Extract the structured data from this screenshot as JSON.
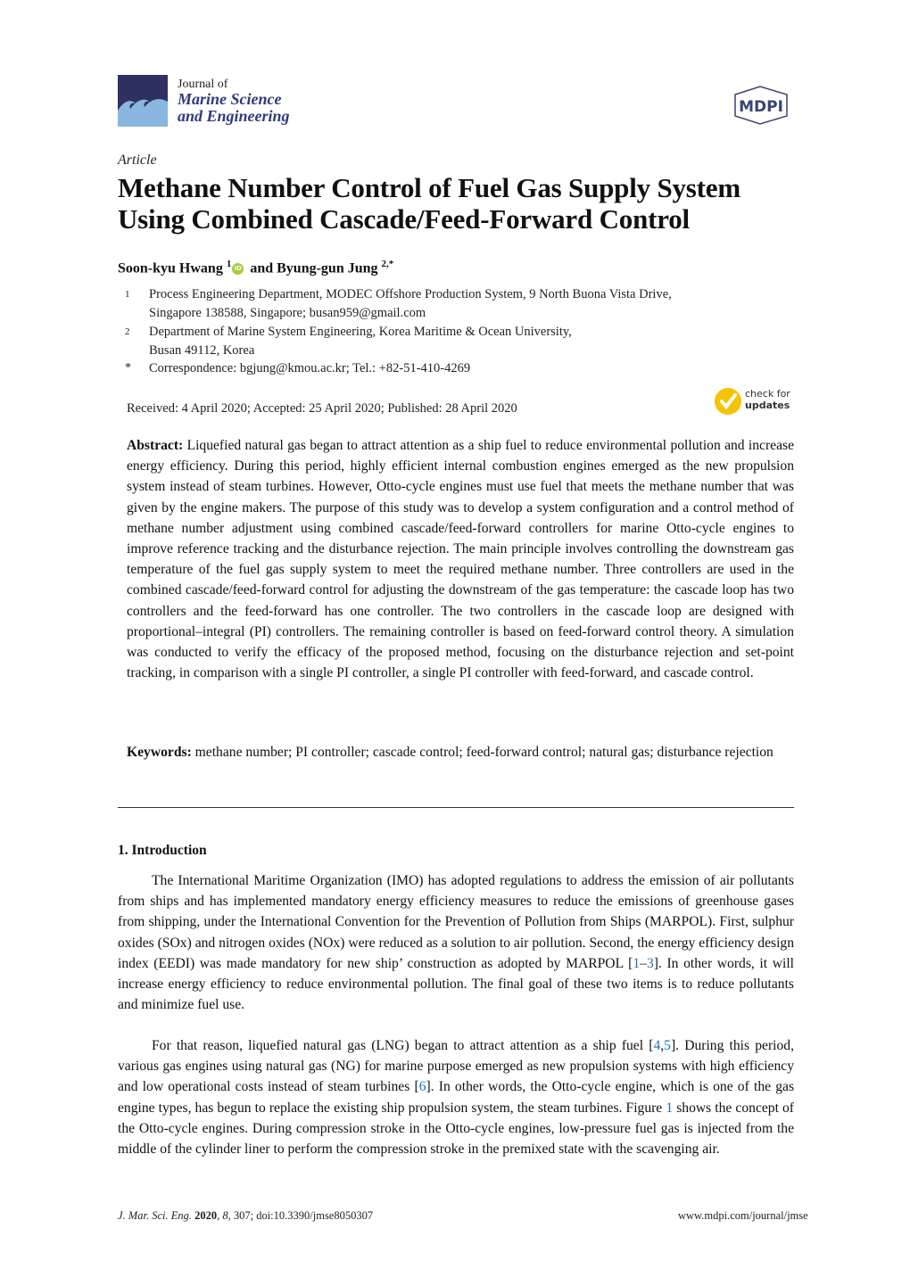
{
  "header": {
    "journal_line1": "Journal of",
    "journal_line2": "Marine Science",
    "journal_line3": "and Engineering",
    "publisher_logo": "MDPI",
    "logo_colors": {
      "navy": "#2f3160",
      "wave": "#8ab6e0",
      "title": "#2f3a7a"
    }
  },
  "article": {
    "type": "Article",
    "title_line1": "Methane Number Control of Fuel Gas Supply System",
    "title_line2": "Using Combined Cascade/Feed-Forward Control"
  },
  "authors": {
    "author1": "Soon-kyu Hwang",
    "author1_sup": "1",
    "and": "and",
    "author2": "Byung-gun Jung",
    "author2_sup": "2,*",
    "orcid_label": "iD"
  },
  "affiliations": [
    {
      "mark": "1",
      "line1": "Process Engineering Department, MODEC Offshore Production System, 9 North Buona Vista Drive,",
      "line2": "Singapore 138588, Singapore; busan959@gmail.com"
    },
    {
      "mark": "2",
      "line1": "Department of Marine System Engineering, Korea Maritime & Ocean University,",
      "line2": "Busan 49112, Korea"
    },
    {
      "mark": "*",
      "line1": "Correspondence: bgjung@kmou.ac.kr; Tel.: +82-51-410-4269"
    }
  ],
  "dates": "Received: 4 April 2020; Accepted: 25 April 2020; Published: 28 April 2020",
  "check_updates": {
    "line1": "check for",
    "line2": "updates",
    "color": "#f5c400"
  },
  "abstract": {
    "label": "Abstract:",
    "text": "Liquefied natural gas began to attract attention as a ship fuel to reduce environmental pollution and increase energy efficiency. During this period, highly efficient internal combustion engines emerged as the new propulsion system instead of steam turbines. However, Otto-cycle engines must use fuel that meets the methane number that was given by the engine makers. The purpose of this study was to develop a system configuration and a control method of methane number adjustment using combined cascade/feed-forward controllers for marine Otto-cycle engines to improve reference tracking and the disturbance rejection. The main principle involves controlling the downstream gas temperature of the fuel gas supply system to meet the required methane number. Three controllers are used in the combined cascade/feed-forward control for adjusting the downstream of the gas temperature: the cascade loop has two controllers and the feed-forward has one controller. The two controllers in the cascade loop are designed with proportional–integral (PI) controllers. The remaining controller is based on feed-forward control theory. A simulation was conducted to verify the efficacy of the proposed method, focusing on the disturbance rejection and set-point tracking, in comparison with a single PI controller, a single PI controller with feed-forward, and cascade control."
  },
  "keywords": {
    "label": "Keywords:",
    "text": "methane number; PI controller; cascade control; feed-forward control; natural gas; disturbance rejection"
  },
  "intro": {
    "heading": "1. Introduction",
    "p1": {
      "a": "The International Maritime Organization (IMO) has adopted regulations to address the emission of air pollutants from ships and has implemented mandatory energy efficiency measures to reduce the emissions of greenhouse gases from shipping, under the International Convention for the Prevention of Pollution from Ships (MARPOL). First, sulphur oxides (SOx) and nitrogen oxides (NOx) were reduced as a solution to air pollution. Second, the energy efficiency design index (EEDI) was made mandatory for new ship’ construction as adopted by MARPOL [",
      "ref1": "1",
      "dash": "–",
      "ref2": "3",
      "b": "]. In other words, it will increase energy efficiency to reduce environmental pollution. The final goal of these two items is to reduce pollutants and minimize fuel use."
    },
    "p2": {
      "a": "For that reason, liquefied natural gas (LNG) began to attract attention as a ship fuel [",
      "ref1": "4",
      "comma": ",",
      "ref2": "5",
      "b": "]. During this period, various gas engines using natural gas (NG) for marine purpose emerged as new propulsion systems with high efficiency and low operational costs instead of steam turbines [",
      "ref3": "6",
      "c": "]. In other words, the Otto-cycle engine, which is one of the gas engine types, has begun to replace the existing ship propulsion system, the steam turbines. Figure ",
      "fig": "1",
      "d": " shows the concept of the Otto-cycle engines. During compression stroke in the Otto-cycle engines, low-pressure fuel gas is injected from the middle of the cylinder liner to perform the compression stroke in the premixed state with the scavenging air."
    }
  },
  "footer": {
    "journal_abbrev": "J. Mar. Sci. Eng.",
    "year": "2020",
    "volume": "8",
    "rest": ", 307; doi:10.3390/jmse8050307",
    "url": "www.mdpi.com/journal/jmse"
  }
}
